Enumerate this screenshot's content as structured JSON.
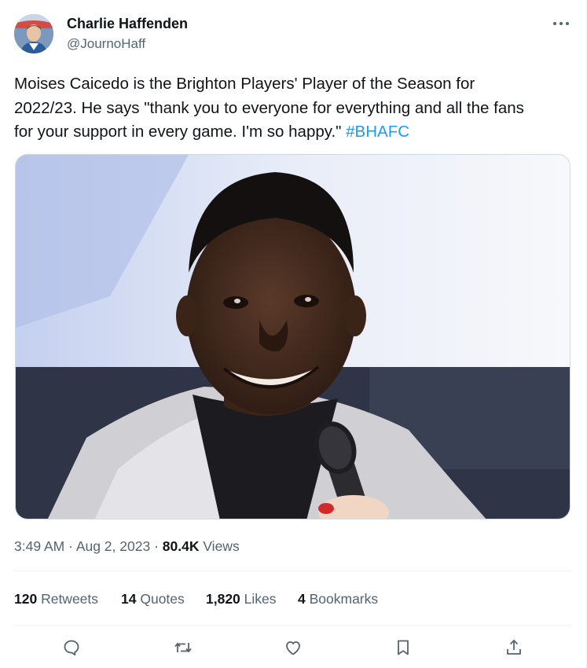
{
  "author": {
    "display_name": "Charlie Haffenden",
    "handle": "@JournoHaff"
  },
  "tweet": {
    "text": "Moises Caicedo is the Brighton Players' Player of the Season for\n2022/23. He says \"thank you to everyone for everything and all the fans\nfor your support in every game. I'm so happy.\" ",
    "hashtag": "#BHAFC"
  },
  "meta": {
    "time": "3:49 AM",
    "separator1": " · ",
    "date": "Aug 2, 2023",
    "separator2": " · ",
    "views_count": "80.4K",
    "views_label": " Views"
  },
  "stats": {
    "retweets_count": "120",
    "retweets_label": "Retweets",
    "quotes_count": "14",
    "quotes_label": "Quotes",
    "likes_count": "1,820",
    "likes_label": "Likes",
    "bookmarks_count": "4",
    "bookmarks_label": "Bookmarks"
  },
  "icons": {
    "more": "more-icon",
    "reply": "reply-icon",
    "retweet": "retweet-icon",
    "like": "like-icon",
    "bookmark": "bookmark-icon",
    "share": "share-icon"
  },
  "colors": {
    "text": "#0f1419",
    "secondary": "#536471",
    "accent": "#1d9bf0",
    "border": "#eff3f4"
  }
}
